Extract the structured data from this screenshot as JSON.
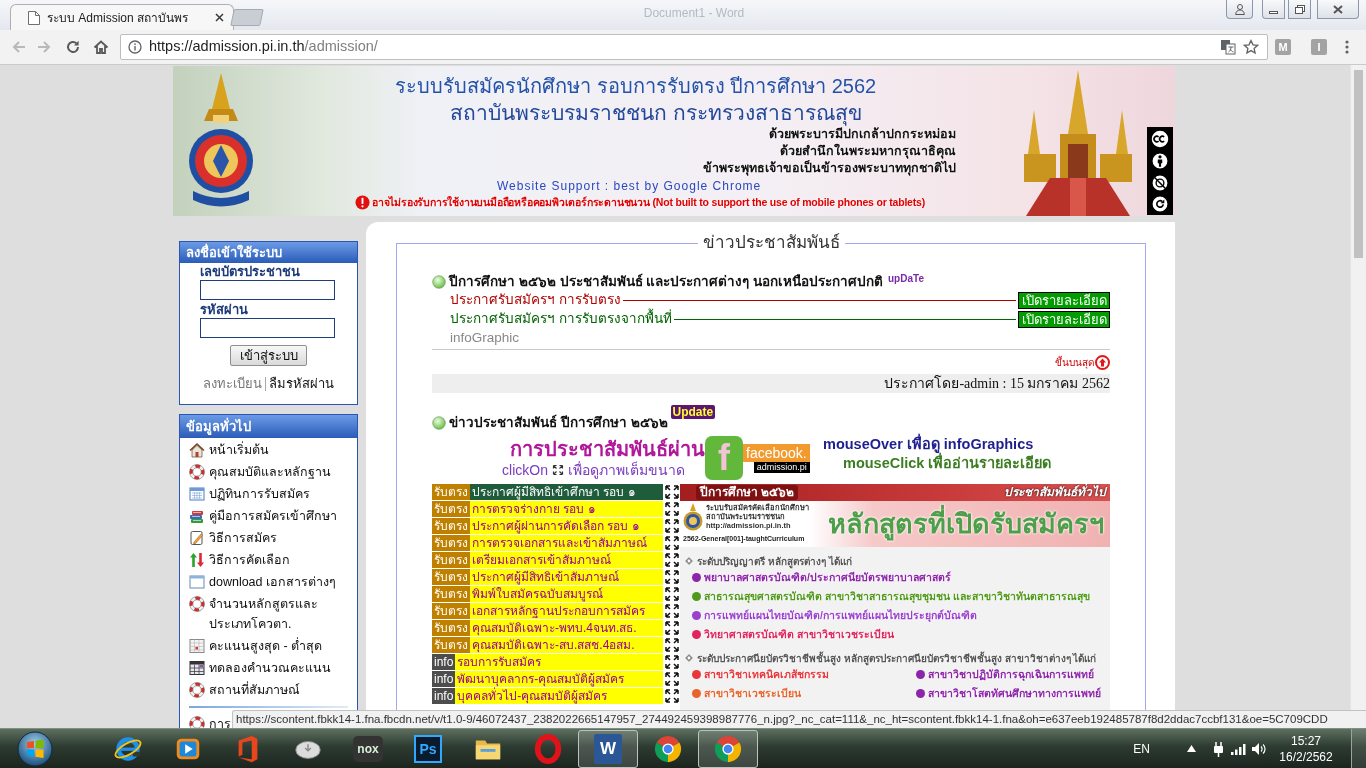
{
  "browser": {
    "tabs": [
      {
        "title": "ระบบ Admission สถาบันพร",
        "selected": true
      }
    ],
    "behind_window_title": "Document1 - Word",
    "back": {
      "disabled": true
    },
    "forward": {
      "disabled": true
    },
    "address": {
      "host": "https://admission.pi.in.th",
      "path": "/admission/"
    },
    "extensions": [
      {
        "glyph": "M"
      },
      {
        "glyph": "I"
      }
    ]
  },
  "banner": {
    "title": "ระบบรับสมัครนักศึกษา รอบการรับตรง ปีการศึกษา 2562",
    "subtitle": "สถาบันพระบรมราชชนก กระทรวงสาธารณสุข",
    "dedication": [
      "ด้วยพระบารมีปกเกล้าปกกระหม่อม",
      "ด้วยสำนึกในพระมหากรุณาธิคุณ",
      "ข้าพระพุทธเจ้าขอเป็นข้ารองพระบาททุกชาติไป"
    ],
    "support_note": "Website Support : best by Google Chrome",
    "warning": "อาจไม่รองรับการใช้งานบนมือถือหรือคอมพิวเตอร์กระดานชนวน (Not built to support the use of mobile phones or tablets)"
  },
  "login": {
    "title": "ลงชื่อเข้าใช้ระบบ",
    "fields": [
      {
        "label": "เลขบัตรประชาชน"
      },
      {
        "label": "รหัสผ่าน"
      }
    ],
    "submit": "เข้าสู่ระบบ",
    "links": [
      {
        "text": "ลงทะเบียน",
        "color": "#777777"
      },
      {
        "text": "ลืมรหัสผ่าน",
        "color": "#111111"
      }
    ]
  },
  "info_menu": {
    "title": "ข้อมูลทั่วไป",
    "items": [
      {
        "label": "หน้าเริ่มต้น",
        "kind": "home"
      },
      {
        "label": "คุณสมบัติและหลักฐาน",
        "kind": "lifebuoy"
      },
      {
        "label": "ปฏิทินการรับสมัคร",
        "kind": "calendar"
      },
      {
        "label": "คู่มือการสมัครเข้าศึกษา",
        "kind": "books"
      },
      {
        "label": "วิธีการสมัคร",
        "kind": "notepad"
      },
      {
        "label": "วิธีการคัดเลือก",
        "kind": "updown"
      },
      {
        "label": "download เอกสารต่างๆ",
        "kind": "window"
      },
      {
        "label": "จำนวนหลักสูตรและประเภทโควตา.",
        "kind": "lifebuoy"
      },
      {
        "label": "คะแนนสูงสุด - ต่ำสุด",
        "kind": "grid"
      },
      {
        "label": "ทดลองคำนวณคะแนน",
        "kind": "planner"
      },
      {
        "label": "สถานที่สัมภาษณ์",
        "kind": "lifebuoy"
      }
    ],
    "more_items": [
      {
        "label": "การ",
        "kind": "lifebuoy"
      }
    ]
  },
  "news": {
    "legend": "ข่าวประชาสัมพันธ์",
    "announcements": {
      "heading": "ปีการศึกษา ๒๕๖๒ ประชาสัมพันธ์ และประกาศต่างๆ นอกเหนือประกาศปกติ",
      "badge": "upDaTe",
      "items": [
        {
          "text": "ประกาศรับสมัครฯ การรับตรง",
          "color": "#b00000",
          "button": "เปิดรายละเอียด"
        },
        {
          "text": "ประกาศรับสมัครฯ การรับตรงจากพื้นที่",
          "color": "#006400",
          "button": "เปิดรายละเอียด"
        },
        {
          "text": "infoGraphic",
          "color": "#888888"
        }
      ],
      "to_top": "ขึ้นบนสุด",
      "posted": "ประกาศโดย-admin : 15 มกราคม 2562"
    },
    "infographics": {
      "heading": "ข่าวประชาสัมพันธ์ ปีการศึกษา ๒๕๖๒",
      "badge": "Update",
      "promo": {
        "title": "การประชาสัมพันธ์ผ่าน",
        "click_prefix": "clickOn",
        "click_suffix": "เพื่อดูภาพเต็มขนาด",
        "logo_glyph": "f",
        "logo_brand": "facebook.",
        "logo_page": "admission.pi",
        "hover_hint": "mouseOver เพื่อดู infoGraphics",
        "click_hint": "mouseClick เพื่ออ่านรายละเอียด"
      },
      "rows": [
        {
          "tag": "รับตรง",
          "kind": "direct",
          "title": "ประกาศผู้มีสิทธิเข้าศึกษา รอบ ๑",
          "selected": true
        },
        {
          "tag": "รับตรง",
          "kind": "direct",
          "title": "การตรวจร่างกาย รอบ ๑",
          "selected": false
        },
        {
          "tag": "รับตรง",
          "kind": "direct",
          "title": "ประกาศผู้ผ่านการคัดเลือก รอบ ๑",
          "selected": false
        },
        {
          "tag": "รับตรง",
          "kind": "direct",
          "title": "การตรวจเอกสารและเข้าสัมภาษณ์",
          "selected": false
        },
        {
          "tag": "รับตรง",
          "kind": "direct",
          "title": "เตรียมเอกสารเข้าสัมภาษณ์",
          "selected": false
        },
        {
          "tag": "รับตรง",
          "kind": "direct",
          "title": "ประกาศผู้มีสิทธิเข้าสัมภาษณ์",
          "selected": false
        },
        {
          "tag": "รับตรง",
          "kind": "direct",
          "title": "พิมพ์ใบสมัครฉบับสมบูรณ์",
          "selected": false
        },
        {
          "tag": "รับตรง",
          "kind": "direct",
          "title": "เอกสารหลักฐานประกอบการสมัคร",
          "selected": false
        },
        {
          "tag": "รับตรง",
          "kind": "direct",
          "title": "คุณสมบัติเฉพาะ-พทบ.4จนท.สธ.",
          "selected": false
        },
        {
          "tag": "รับตรง",
          "kind": "direct",
          "title": "คุณสมบัติเฉพาะ-สบ.สสช.4อสม.",
          "selected": false
        },
        {
          "tag": "info",
          "kind": "info",
          "title": "รอบการรับสมัคร",
          "selected": false
        },
        {
          "tag": "info",
          "kind": "info",
          "title": "พัฒนาบุคลากร-คุณสมบัติผู้สมัคร",
          "selected": false
        },
        {
          "tag": "info",
          "kind": "info",
          "title": "บุคคลทั่วไป-คุณสมบัติผู้สมัคร",
          "selected": false
        }
      ],
      "infographic": {
        "year": "ปีการศึกษา ๒๕๖๒",
        "category": "ประชาสัมพันธ์ทั่วไป",
        "org_lines": [
          "ระบบรับสมัครคัดเลือกนักศึกษา",
          "สถาบันพระบรมราชชนก",
          "http://admission.pi.in.th"
        ],
        "code": "2562-General[001]-taughtCurriculum",
        "title": "หลักสูตรที่เปิดรับสมัครฯ",
        "groups": [
          {
            "heading": "ระดับปริญญาตรี หลักสูตรต่างๆ ได้แก่",
            "kind": "list",
            "items": [
              {
                "text": "พยาบาลศาสตรบัณฑิต/ประกาศนียบัตรพยาบาลศาสตร์",
                "color": "#8e24aa"
              },
              {
                "text": "สาธารณสุขศาสตรบัณฑิต สาขาวิชาสาธารณสุขชุมชน และสาขาวิชาทันตสาธารณสุข",
                "color": "#4f9a1a"
              },
              {
                "text": "การแพทย์แผนไทยบัณฑิต/การแพทย์แผนไทยประยุกต์บัณฑิต",
                "color": "#9b3fcf"
              },
              {
                "text": "วิทยาศาสตรบัณฑิต สาขาวิชาเวชระเบียน",
                "color": "#e0245e"
              }
            ]
          },
          {
            "heading": "ระดับประกาศนียบัตรวิชาชีพชั้นสูง หลักสูตรประกาศนียบัตรวิชาชีพชั้นสูง สาขาวิชาต่างๆ ได้แก่",
            "kind": "grid",
            "items": [
              {
                "text": "สาขาวิชาเทคนิคเภสัชกรรม",
                "color": "#e8363a"
              },
              {
                "text": "สาขาวิชาปฏิบัติการฉุกเฉินการแพทย์",
                "color": "#8e24aa"
              },
              {
                "text": "สาขาวิชาเวชระเบียน",
                "color": "#e8642a"
              },
              {
                "text": "สาขาวิชาโสตทัศนศึกษาทางการแพทย์",
                "color": "#8e24aa"
              }
            ]
          }
        ]
      }
    }
  },
  "status_url": "https://scontent.fbkk14-1.fna.fbcdn.net/v/t1.0-9/46072437_2382022665147957_274492459398987776_n.jpg?_nc_cat=111&_nc_ht=scontent.fbkk14-1.fna&oh=e637eeb192485787f8d2ddac7ccbf131&oe=5C709CDD",
  "taskbar": {
    "apps": [
      {
        "kind": "ie",
        "running": false
      },
      {
        "kind": "media",
        "running": false
      },
      {
        "kind": "office",
        "running": false
      },
      {
        "kind": "drive",
        "running": false
      },
      {
        "kind": "nox",
        "glyph": "nox",
        "running": false
      },
      {
        "kind": "photoshop",
        "glyph": "Ps",
        "running": false
      },
      {
        "kind": "explorer",
        "running": false
      },
      {
        "kind": "opera",
        "running": false
      },
      {
        "kind": "word",
        "glyph": "W",
        "running": true
      },
      {
        "kind": "chrome",
        "running": false
      },
      {
        "kind": "chrome",
        "running": true
      }
    ],
    "language": "EN",
    "time": "15:27",
    "date": "16/2/2562"
  }
}
